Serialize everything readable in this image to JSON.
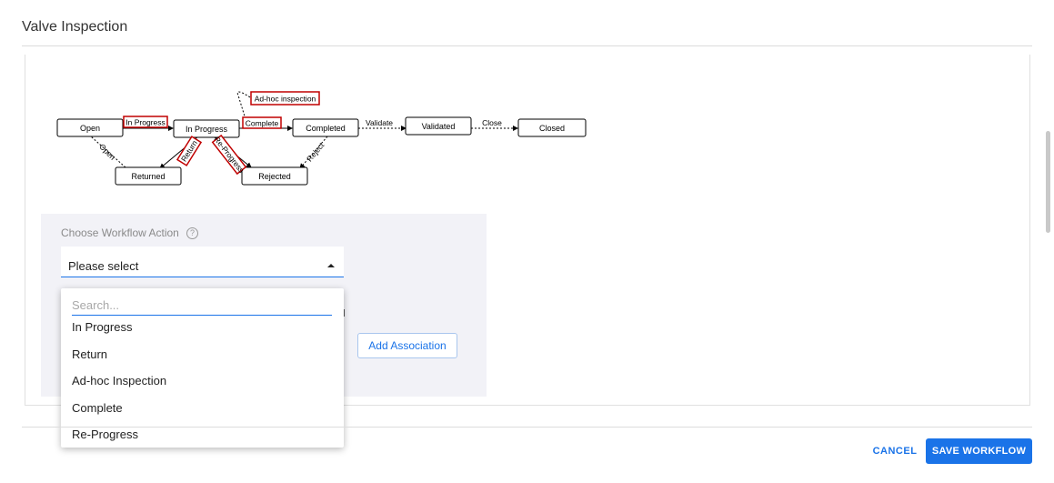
{
  "header": {
    "title": "Valve Inspection"
  },
  "diagram": {
    "states": {
      "open": "Open",
      "in_progress": "In Progress",
      "completed": "Completed",
      "validated": "Validated",
      "closed": "Closed",
      "returned": "Returned",
      "rejected": "Rejected"
    },
    "transitions": {
      "in_progress": "In Progress",
      "complete": "Complete",
      "adhoc": "Ad-hoc inspection",
      "validate": "Validate",
      "close": "Close",
      "return": "Return",
      "re_progress": "Re-Progress",
      "open": "Open",
      "reject": "Reject"
    },
    "highlight_color": "#c00000"
  },
  "workflow": {
    "label": "Choose Workflow Action",
    "help_icon": "?",
    "select_value": "Please select",
    "search_placeholder": "Search...",
    "options": [
      "In Progress",
      "Return",
      "Ad-hoc Inspection",
      "Complete",
      "Re-Progress"
    ],
    "add_association": "Add Association"
  },
  "footer": {
    "cancel": "CANCEL",
    "save": "SAVE WORKFLOW"
  },
  "colors": {
    "accent": "#1a73e8",
    "panel": "#f2f2f7"
  }
}
